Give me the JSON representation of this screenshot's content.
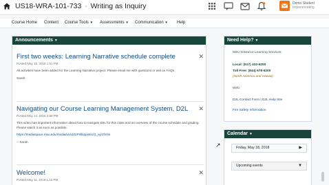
{
  "topbar": {
    "course_code": "US18-WRA-101-733",
    "separator": "-",
    "course_name": "Writing as Inquiry",
    "user_name": "Demo Student",
    "user_role": "Impersonating"
  },
  "nav": {
    "items": [
      "Course Home",
      "Content",
      "Course Tools",
      "Assessments",
      "Communication",
      "Help"
    ]
  },
  "announcements": {
    "header": "Announcements",
    "items": [
      {
        "title": "First two weeks: Learning Narrative schedule complete",
        "date": "Posted May 15, 2018 1:51 PM",
        "body": "All activities have been added for the Learning Narrative project. Please email me with questions or ask on FAQs.",
        "sign": "Sarah"
      },
      {
        "title": "Navigating our Course Learning Management System, D2L",
        "date": "Posted May 14, 2018 2:58 PM",
        "body": "This video has important information about how to navigate D2L for this class and an overview of the course schedule and grading. Please watch it as soon as possible.",
        "link": "https://mediaspace.msu.edu/media/wra101PrilliIppintro/1_vyrzfmhs",
        "sign": "-- Sarah"
      },
      {
        "title": "Welcome!",
        "date": "Posted May 11, 2018 1:22 PM"
      }
    ]
  },
  "help": {
    "header": "Need Help?",
    "services_title": "MSU Distance Learning Services:",
    "local": "Local: (517) 432-6200",
    "tollfree": "Toll Free: (844) 678-6200",
    "region": "(North America and Hawaii)",
    "web_label": "Web:",
    "links": "D2L Contact Form | D2L Help Site",
    "fire": "Fire Safety Information"
  },
  "calendar": {
    "header": "Calendar",
    "date": "Friday, May 18, 2018",
    "upcoming": "Upcoming events"
  }
}
